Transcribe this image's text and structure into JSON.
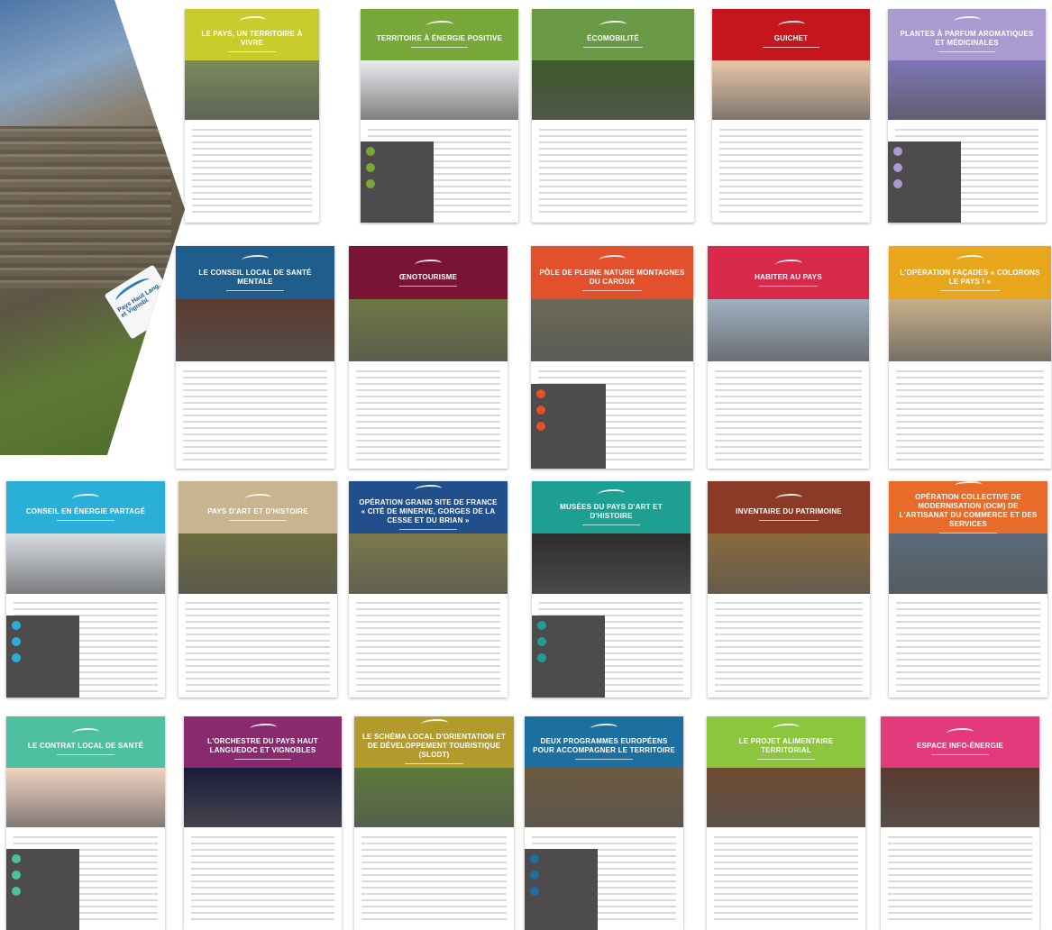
{
  "cover": {
    "label_line1": "Pays Haut Lang.",
    "label_line2": "et Vignobl."
  },
  "cards": [
    {
      "title": "LE PAYS, UN TERRITOIRE À VIVRE",
      "color": "#c9cd2c",
      "photo": "#7b8a5b"
    },
    {
      "title": "TERRITOIRE À ÉNERGIE POSITIVE",
      "color": "#78a83c",
      "photo": "#e9ecef"
    },
    {
      "title": "ÉCOMOBILITÉ",
      "color": "#6a9a45",
      "photo": "#3f5a2a"
    },
    {
      "title": "GUICHET",
      "color": "#c4161c",
      "photo": "#e8c7a8"
    },
    {
      "title": "PLANTES À PARFUM AROMATIQUES ET MÉDICINALES",
      "color": "#a99bd0",
      "photo": "#7d76b8"
    },
    {
      "title": "LE CONSEIL LOCAL DE SANTÉ MENTALE",
      "color": "#1f5d8d",
      "photo": "#5b3b2f"
    },
    {
      "title": "ŒNOTOURISME",
      "color": "#7a1434",
      "photo": "#6c7842"
    },
    {
      "title": "PÔLE DE PLEINE NATURE MONTAGNES DU CAROUX",
      "color": "#e2512b",
      "photo": "#6b6a58"
    },
    {
      "title": "HABITER AU PAYS",
      "color": "#d9294a",
      "photo": "#9fb0c1"
    },
    {
      "title": "L'OPÉRATION FAÇADES « COLORONS LE PAYS ! »",
      "color": "#e8a61d",
      "photo": "#c7b08a"
    },
    {
      "title": "CONSEIL EN ÉNERGIE PARTAGÉ",
      "color": "#2ab0d8",
      "photo": "#d8dde2"
    },
    {
      "title": "PAYS D'ART ET D'HISTOIRE",
      "color": "#c9b490",
      "photo": "#6b6b3c"
    },
    {
      "title": "OPÉRATION GRAND SITE DE FRANCE « CITÉ DE MINERVE, GORGES DE LA CESSE ET DU BRIAN »",
      "color": "#214f8c",
      "photo": "#7c7a4a"
    },
    {
      "title": "MUSÉES DU PAYS D'ART ET D'HISTOIRE",
      "color": "#1d9f91",
      "photo": "#2e2d2b"
    },
    {
      "title": "INVENTAIRE DU PATRIMOINE",
      "color": "#8a3a26",
      "photo": "#8a6b3c"
    },
    {
      "title": "OPÉRATION COLLECTIVE DE MODERNISATION (OCM) DE L'ARTISANAT DU COMMERCE ET DES SERVICES",
      "color": "#e86b2a",
      "photo": "#5a6b7c"
    },
    {
      "title": "LE CONTRAT LOCAL DE SANTÉ",
      "color": "#4ec0a0",
      "photo": "#f2d4c2"
    },
    {
      "title": "L'ORCHESTRE DU PAYS HAUT LANGUEDOC ET VIGNOBLES",
      "color": "#8a2a6e",
      "photo": "#1a1a3a"
    },
    {
      "title": "LE SCHÉMA LOCAL D'ORIENTATION ET DE DÉVELOPPEMENT TOURISTIQUE (SLODT)",
      "color": "#b39a2c",
      "photo": "#5b7a3a"
    },
    {
      "title": "DEUX PROGRAMMES EUROPÉENS POUR ACCOMPAGNER LE TERRITOIRE",
      "color": "#1d6fa0",
      "photo": "#6d5a40"
    },
    {
      "title": "LE PROJET ALIMENTAIRE TERRITORIAL",
      "color": "#8cc63f",
      "photo": "#6d4a30"
    },
    {
      "title": "ESPACE INFO-ÉNERGIE",
      "color": "#e23a7a",
      "photo": "#5a3a2e"
    }
  ]
}
